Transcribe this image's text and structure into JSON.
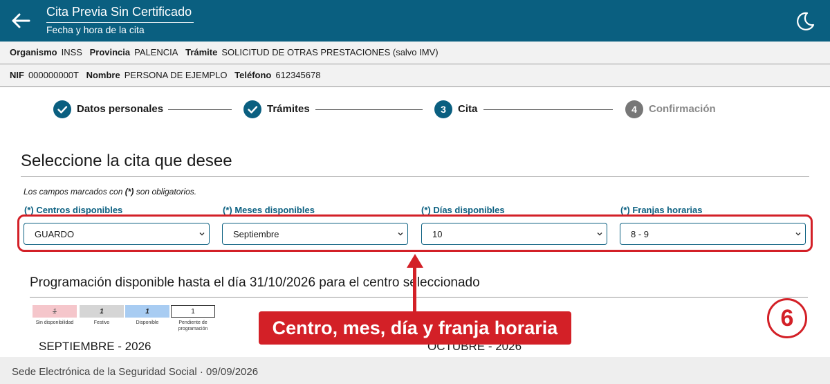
{
  "header": {
    "title": "Cita Previa Sin Certificado",
    "subtitle": "Fecha y hora de la cita",
    "back_icon": "arrow-left-icon",
    "theme_icon": "moon-icon"
  },
  "info": {
    "organismo_label": "Organismo",
    "organismo_value": "INSS",
    "provincia_label": "Provincia",
    "provincia_value": "PALENCIA",
    "tramite_label": "Trámite",
    "tramite_value": "SOLICITUD DE OTRAS PRESTACIONES (salvo IMV)",
    "nif_label": "NIF",
    "nif_value": "000000000T",
    "nombre_label": "Nombre",
    "nombre_value": "PERSONA DE EJEMPLO",
    "telefono_label": "Teléfono",
    "telefono_value": "612345678"
  },
  "stepper": {
    "steps": [
      {
        "label": "Datos personales",
        "state": "done",
        "icon": "check-icon"
      },
      {
        "label": "Trámites",
        "state": "done",
        "icon": "check-icon"
      },
      {
        "label": "Cita",
        "state": "active",
        "number": "3"
      },
      {
        "label": "Confirmación",
        "state": "pending",
        "number": "4"
      }
    ]
  },
  "form": {
    "title": "Seleccione la cita que desee",
    "required_prefix": "Los campos marcados con ",
    "required_mark": "(*)",
    "required_suffix": " son obligatorios.",
    "fields": [
      {
        "label": "(*) Centros disponibles",
        "value": "GUARDO"
      },
      {
        "label": "(*) Meses disponibles",
        "value": "Septiembre"
      },
      {
        "label": "(*) Días disponibles",
        "value": "10"
      },
      {
        "label": "(*) Franjas horarias",
        "value": "8 - 9"
      }
    ]
  },
  "programacion": {
    "title": "Programación disponible hasta el día 31/10/2026 para el centro seleccionado",
    "legend": [
      {
        "sample": "1",
        "label": "Sin disponibilidad",
        "color": "#f5c6cb"
      },
      {
        "sample": "1",
        "label": "Festivo",
        "color": "#d5d5d5"
      },
      {
        "sample": "1",
        "label": "Disponible",
        "color": "#a8ccf2"
      },
      {
        "sample": "1",
        "label": "Pendiente de programación",
        "color": "#ffffff"
      }
    ],
    "months": [
      "SEPTIEMBRE - 2026",
      "OCTUBRE - 2026"
    ]
  },
  "annotation": {
    "callout": "Centro, mes, día y franja horaria",
    "badge": "6",
    "color": "#d32027"
  },
  "footer": {
    "text": "Sede Electrónica de la Seguridad Social · 09/09/2026"
  },
  "colors": {
    "brand": "#0a5f80",
    "accent": "#d32027"
  }
}
